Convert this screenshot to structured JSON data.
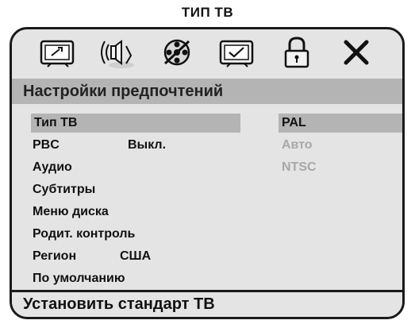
{
  "caption": "ТИП ТВ",
  "icons": [
    "tv-setup-icon",
    "audio-speaker-icon",
    "video-reel-icon",
    "preferences-check-icon",
    "lock-icon",
    "close-icon"
  ],
  "section_title": "Настройки предпочтений",
  "menu": [
    {
      "label": "Тип ТВ",
      "value": ""
    },
    {
      "label": "PBC",
      "value": "Выкл."
    },
    {
      "label": "Аудио",
      "value": ""
    },
    {
      "label": "Субтитры",
      "value": ""
    },
    {
      "label": "Меню диска",
      "value": ""
    },
    {
      "label": "Родит. контроль",
      "value": ""
    },
    {
      "label": "Регион",
      "value": "США"
    },
    {
      "label": "По умолчанию",
      "value": ""
    }
  ],
  "options": [
    "PAL",
    "Авто",
    "NTSC"
  ],
  "status": "Установить стандарт ТВ",
  "colors": {
    "highlight": "#b4b4b4",
    "panel": "#e4e4e4",
    "border": "#1a1a1a",
    "disabled": "#a8a8a8"
  }
}
